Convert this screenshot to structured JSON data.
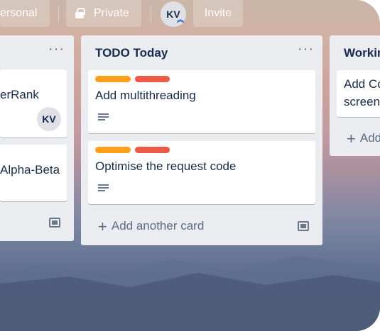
{
  "header": {
    "visibility_partial_label": "ersonal",
    "privacy_label": "Private",
    "member_initials": "KV",
    "invite_label": "Invite"
  },
  "lists": {
    "left": {
      "cards": [
        {
          "text": "erRank",
          "member_initials": "KV"
        },
        {
          "text": "Alpha-Beta"
        }
      ]
    },
    "middle": {
      "title": "TODO Today",
      "menu_icon": "ellipsis-icon",
      "cards": [
        {
          "text": "Add multithreading",
          "labels": [
            "orange",
            "red"
          ],
          "has_description": true
        },
        {
          "text": "Optimise the request code",
          "labels": [
            "orange",
            "red"
          ],
          "has_description": true
        }
      ],
      "add_card_label": "Add another card"
    },
    "right": {
      "title": "Workin",
      "cards": [
        {
          "line1": "Add Co",
          "line2": "screen"
        }
      ],
      "add_card_label": "Add"
    }
  },
  "colors": {
    "label_orange": "#ff9f1a",
    "label_red": "#eb5a46",
    "list_bg": "#ebecf0"
  }
}
